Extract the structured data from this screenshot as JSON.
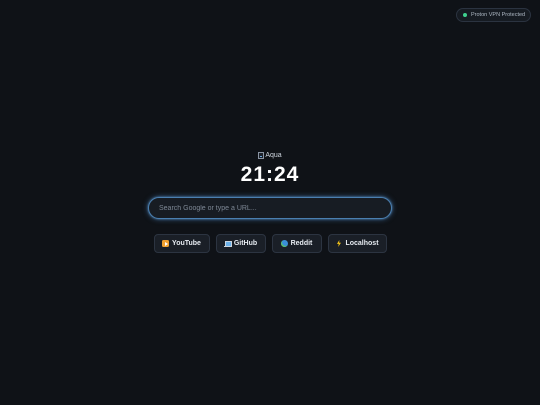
{
  "vpn": {
    "label": "Proton VPN Protected",
    "status_color": "#3ecf8e"
  },
  "logo": {
    "alt": "Aqua",
    "icon": "broken-image-icon"
  },
  "clock": {
    "time": "21:24"
  },
  "search": {
    "placeholder": "Search Google or type a URL...",
    "value": "",
    "accent": "#4a7fb0"
  },
  "quick_links": [
    {
      "label": "YouTube",
      "icon": "play-icon"
    },
    {
      "label": "GitHub",
      "icon": "laptop-icon"
    },
    {
      "label": "Reddit",
      "icon": "globe-icon"
    },
    {
      "label": "Localhost",
      "icon": "lightning-icon"
    }
  ],
  "colors": {
    "background": "#0f1217",
    "button_bg": "#1a1f27"
  }
}
